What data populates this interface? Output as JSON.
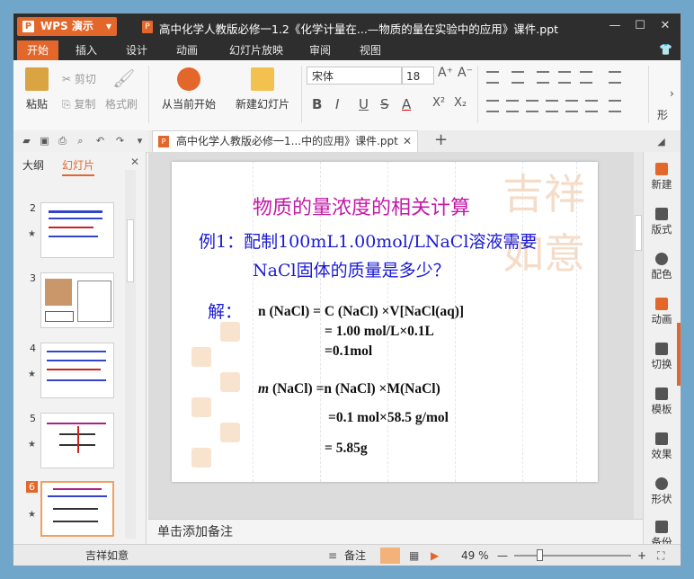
{
  "app": {
    "name": "WPS 演示",
    "doc_badge": "P"
  },
  "window": {
    "title": "高中化学人教版必修一1.2《化学计量在...—物质的量在实验中的应用》课件.ppt"
  },
  "window_controls": {
    "minimize": "—",
    "maximize": "☐",
    "close": "✕"
  },
  "menu": {
    "tabs": [
      "开始",
      "插入",
      "设计",
      "动画",
      "幻灯片放映",
      "审阅",
      "视图"
    ]
  },
  "ribbon": {
    "paste": "粘贴",
    "cut": "剪切",
    "copy": "复制",
    "format_painter": "格式刷",
    "from_current": "从当前开始",
    "new_slide": "新建幻灯片",
    "font_name": "宋体",
    "font_size": "18",
    "bold": "B",
    "italic": "I",
    "underline": "U",
    "strike": "S",
    "font_color": "A",
    "grow": "A⁺",
    "shrink": "A⁻",
    "superscript": "X²",
    "subscript": "X₂",
    "shape_partial": "形"
  },
  "doc_tab": {
    "title": "高中化学人教版必修一1...中的应用》课件.ppt",
    "close": "✕",
    "new": "+"
  },
  "left_panel": {
    "tabs": [
      "大纲",
      "幻灯片"
    ],
    "close": "✕",
    "slides": [
      {
        "num": "2",
        "star": "★"
      },
      {
        "num": "3",
        "star": ""
      },
      {
        "num": "4",
        "star": "★"
      },
      {
        "num": "5",
        "star": "★"
      },
      {
        "num": "6",
        "star": "★"
      }
    ]
  },
  "slide": {
    "title": "物质的量浓度的相关计算",
    "example_line1": "例1：配制100mL1.00mol/LNaCl溶液需要",
    "example_line2": "NaCl固体的质量是多少？",
    "answer_label": "解：",
    "eq1": "n (NaCl) = C (NaCl) ×V[NaCl(aq)]",
    "eq2": "= 1.00 mol/L×0.1L",
    "eq3": "=0.1mol",
    "eq4_m": "m",
    "eq4_rest": " (NaCl) =n (NaCl) ×M(NaCl)",
    "eq5": "=0.1 mol×58.5 g/mol",
    "eq6": "= 5.85g",
    "watermark": "吉祥如意"
  },
  "notes": {
    "placeholder": "单击添加备注"
  },
  "right_bar": {
    "items": [
      "新建",
      "版式",
      "配色",
      "动画",
      "切换",
      "模板",
      "效果",
      "形状",
      "备份"
    ]
  },
  "status": {
    "theme": "吉祥如意",
    "notes": "备注",
    "zoom": "49 %",
    "minus": "—",
    "plus": "+"
  },
  "colors": {
    "accent": "#e3672a",
    "title_purple": "#c41aa8",
    "example_blue": "#1a1ad4",
    "answer_blue": "#1a1ad4"
  }
}
